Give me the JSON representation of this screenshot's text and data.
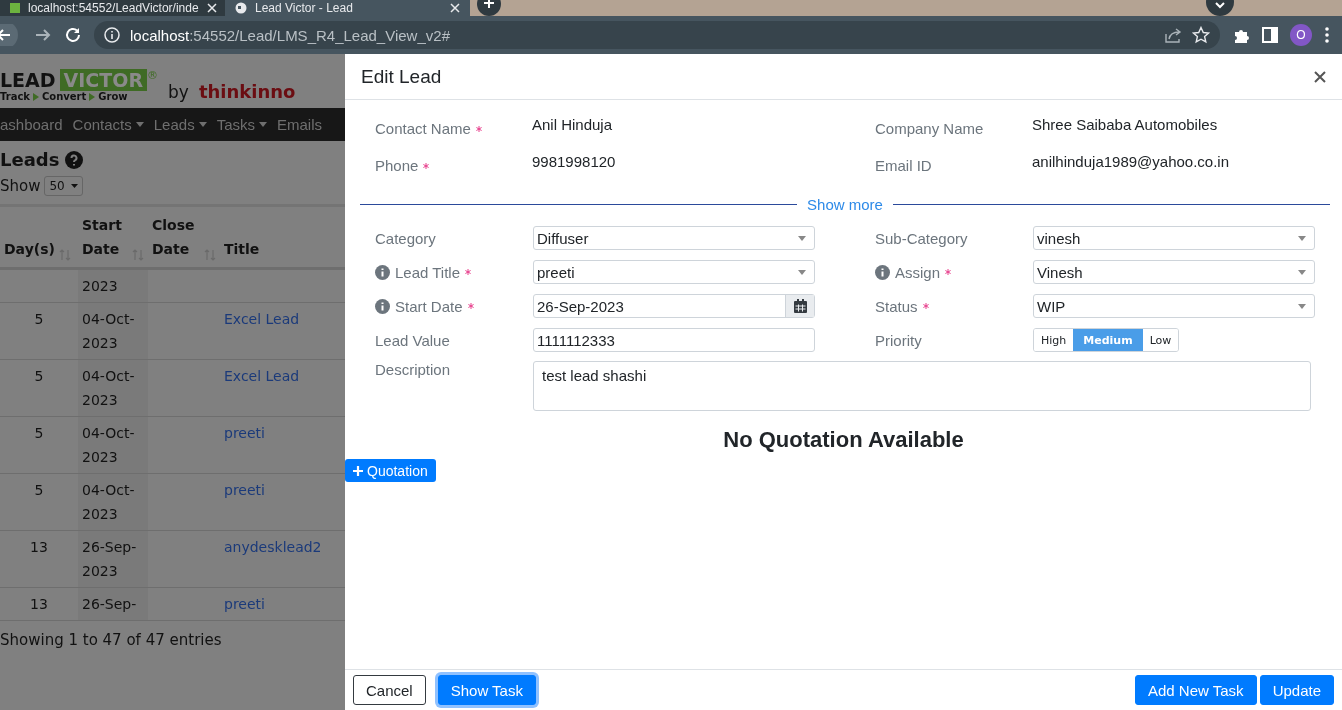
{
  "browser": {
    "tabs": [
      {
        "title": "localhost:54552/LeadVictor/inde",
        "selected": false
      },
      {
        "title": "Lead Victor - Lead",
        "selected": true
      }
    ],
    "address": {
      "host": "localhost",
      "path": ":54552/Lead/LMS_R4_Lead_View_v2#"
    },
    "profile_initial": "O"
  },
  "background_page": {
    "logo": {
      "word1": "LEAD",
      "word2": "VICTOR",
      "mark": "®",
      "tagline": [
        "Track",
        "Convert",
        "Grow"
      ],
      "by": "by",
      "company": "thinkinno"
    },
    "nav": [
      {
        "label": "ashboard",
        "dropdown": false
      },
      {
        "label": "Contacts",
        "dropdown": true
      },
      {
        "label": "Leads",
        "dropdown": true
      },
      {
        "label": "Tasks",
        "dropdown": true
      },
      {
        "label": "Emails",
        "dropdown": false
      }
    ],
    "heading": "Leads",
    "show_label": "Show",
    "page_size": "50",
    "table": {
      "columns": [
        {
          "label": "Day(s)",
          "sortable": true
        },
        {
          "label": "Start Date",
          "sortable": true
        },
        {
          "label": "Close Date",
          "sortable": true
        },
        {
          "label": "Title",
          "sortable": false
        }
      ],
      "rows": [
        {
          "start": "2023"
        },
        {
          "days": "5",
          "start": "04-Oct-2023",
          "title": "Excel Lead"
        },
        {
          "days": "5",
          "start": "04-Oct-2023",
          "title": "Excel Lead"
        },
        {
          "days": "5",
          "start": "04-Oct-2023",
          "title": "preeti"
        },
        {
          "days": "5",
          "start": "04-Oct-2023",
          "title": "preeti"
        },
        {
          "days": "13",
          "start": "26-Sep-2023",
          "title": "anydesklead2"
        },
        {
          "days": "13",
          "start": "26-Sep-",
          "title": "preeti"
        }
      ]
    },
    "info": "Showing 1 to 47 of 47 entries"
  },
  "modal": {
    "title": "Edit Lead",
    "contact": [
      {
        "label": "Contact Name",
        "required": true,
        "value": "Anil Hinduja"
      },
      {
        "label": "Company Name",
        "required": false,
        "value": "Shree Saibaba Automobiles"
      },
      {
        "label": "Phone",
        "required": true,
        "value": "9981998120"
      },
      {
        "label": "Email ID",
        "required": false,
        "value": "anilhinduja1989@yahoo.co.in"
      }
    ],
    "show_more": "Show more",
    "fields": [
      {
        "kind": "select",
        "label": "Category",
        "info": false,
        "required": false,
        "value": "Diffuser"
      },
      {
        "kind": "select",
        "label": "Sub-Category",
        "info": false,
        "required": false,
        "value": "vinesh"
      },
      {
        "kind": "select",
        "label": "Lead Title",
        "info": true,
        "required": true,
        "value": "preeti"
      },
      {
        "kind": "select",
        "label": "Assign",
        "info": true,
        "required": true,
        "value": "Vinesh"
      },
      {
        "kind": "date",
        "label": "Start Date",
        "info": true,
        "required": true,
        "value": "26-Sep-2023"
      },
      {
        "kind": "select",
        "label": "Status",
        "info": false,
        "required": true,
        "value": "WIP"
      },
      {
        "kind": "text",
        "label": "Lead Value",
        "info": false,
        "required": false,
        "value": "1111112333"
      },
      {
        "kind": "priority",
        "label": "Priority",
        "info": false,
        "required": false,
        "options": [
          {
            "label": "High",
            "selected": false
          },
          {
            "label": "Medium",
            "selected": true
          },
          {
            "label": "Low",
            "selected": false
          }
        ]
      },
      {
        "kind": "textarea",
        "label": "Description",
        "info": false,
        "required": false,
        "value": "test lead shashi"
      }
    ],
    "quotation_message": "No Quotation Available",
    "quotation_button": "Quotation",
    "footer_left_buttons": [
      {
        "label": "Cancel",
        "kind": "outline",
        "focused": false
      },
      {
        "label": "Show Task",
        "kind": "primary",
        "focused": true
      }
    ],
    "footer_right_buttons": [
      {
        "label": "Add New Task",
        "kind": "primary",
        "focused": false
      },
      {
        "label": "Update",
        "kind": "primary",
        "focused": false
      }
    ]
  }
}
